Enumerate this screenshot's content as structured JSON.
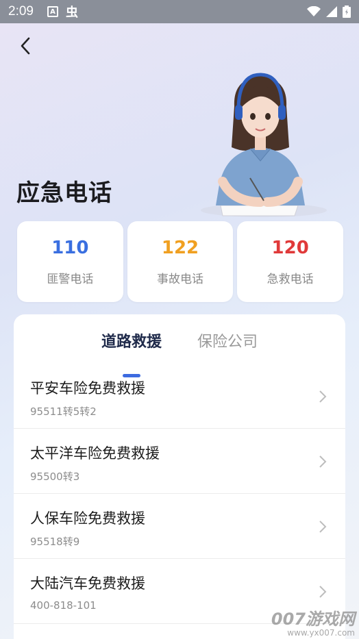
{
  "status_bar": {
    "time": "2:09",
    "icons": [
      "font-icon",
      "bug-icon",
      "wifi-icon",
      "signal-icon",
      "battery-icon"
    ]
  },
  "page": {
    "title": "应急电话"
  },
  "quick_calls": [
    {
      "number": "110",
      "label": "匪警电话",
      "color": "#3a6fe0"
    },
    {
      "number": "122",
      "label": "事故电话",
      "color": "#f0a021"
    },
    {
      "number": "120",
      "label": "急救电话",
      "color": "#e03a3a"
    }
  ],
  "tabs": [
    {
      "label": "道路救援",
      "active": true
    },
    {
      "label": "保险公司",
      "active": false
    }
  ],
  "rescue_list": [
    {
      "title": "平安车险免费救援",
      "phone": "95511转5转2"
    },
    {
      "title": "太平洋车险免费救援",
      "phone": "95500转3"
    },
    {
      "title": "人保车险免费救援",
      "phone": "95518转9"
    },
    {
      "title": "大陆汽车免费救援",
      "phone": "400-818-101"
    }
  ],
  "watermark": {
    "brand": "007游戏网",
    "url": "www.yx007.com"
  },
  "colors": {
    "accent": "#3d6be0",
    "active_tab": "#1f2a4a"
  }
}
